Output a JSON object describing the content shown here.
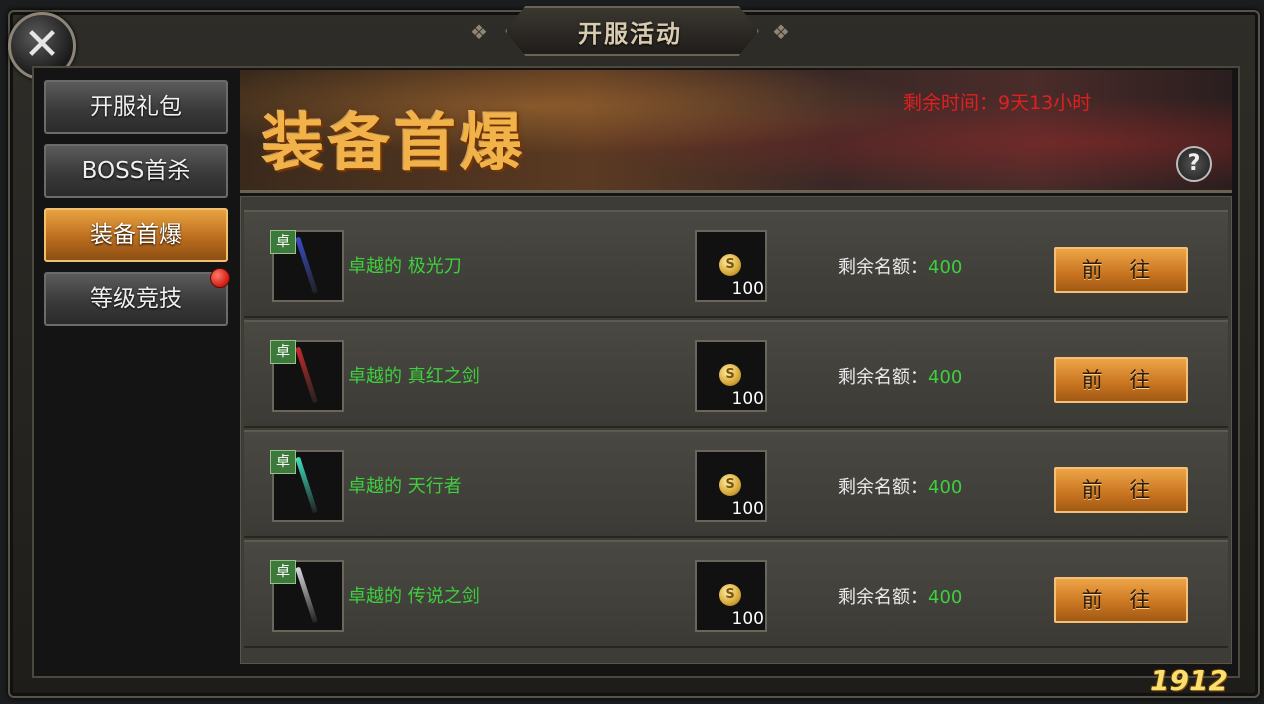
{
  "window": {
    "title": "开服活动"
  },
  "sidebar": {
    "items": [
      {
        "label": "开服礼包",
        "active": false,
        "has_notification": false
      },
      {
        "label": "BOSS首杀",
        "active": false,
        "has_notification": false
      },
      {
        "label": "装备首爆",
        "active": true,
        "has_notification": false
      },
      {
        "label": "等级竞技",
        "active": false,
        "has_notification": true
      }
    ]
  },
  "banner": {
    "title": "装备首爆",
    "remaining_time": "剩余时间：9天13小时",
    "help_icon": "?"
  },
  "rows": [
    {
      "badge": "卓",
      "name": "卓越的 极光刀",
      "cost": "100",
      "quota_label": "剩余名额：",
      "quota": "400",
      "action": "前 往",
      "weapon_color": "#3a4cc8"
    },
    {
      "badge": "卓",
      "name": "卓越的 真红之剑",
      "cost": "100",
      "quota_label": "剩余名额：",
      "quota": "400",
      "action": "前 往",
      "weapon_color": "#c82a2a"
    },
    {
      "badge": "卓",
      "name": "卓越的 天行者",
      "cost": "100",
      "quota_label": "剩余名额：",
      "quota": "400",
      "action": "前 往",
      "weapon_color": "#3fe0c0"
    },
    {
      "badge": "卓",
      "name": "卓越的 传说之剑",
      "cost": "100",
      "quota_label": "剩余名额：",
      "quota": "400",
      "action": "前 往",
      "weapon_color": "#d8d8e0"
    }
  ],
  "coin_symbol": "S",
  "watermark": "1912"
}
